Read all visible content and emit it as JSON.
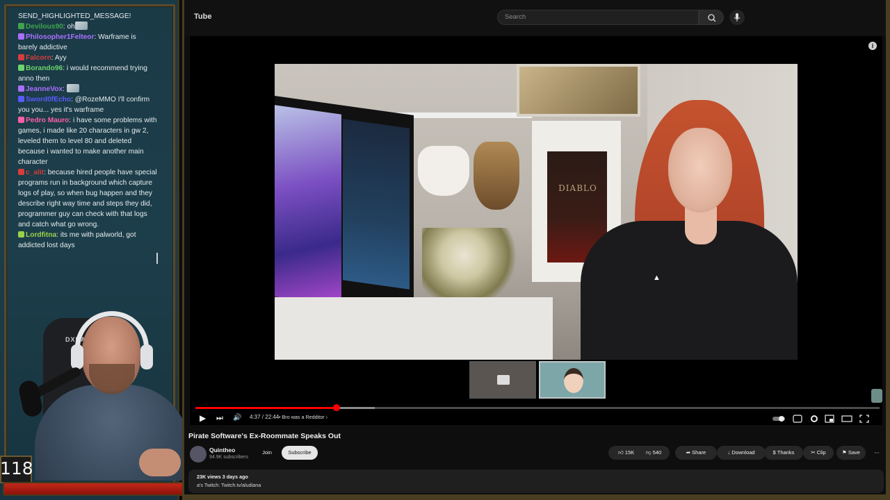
{
  "chat": {
    "messages": [
      {
        "user": "",
        "user_color": "#e8ecef",
        "text": "SEND_HIGHLIGHTED_MESSAGE!"
      },
      {
        "user": "Devilous90",
        "user_color": "#3fa34d",
        "text": "oh",
        "emote": true
      },
      {
        "user": "Philosopher1Felteor",
        "user_color": "#a970ff",
        "text": "Warframe is barely addictive"
      },
      {
        "user": "Falcorn",
        "user_color": "#d63c3c",
        "text": "Ayy"
      },
      {
        "user": "Borando96",
        "user_color": "#6bd36b",
        "text": "i would recommend trying anno then"
      },
      {
        "user": "JeanneVox",
        "user_color": "#a970ff",
        "text": "",
        "emote": true
      },
      {
        "user": "Sword0fEcho",
        "user_color": "#5b5bff",
        "text": "@RozeMMO I'll confirm you you... yes it's warframe"
      },
      {
        "user": "Pedro Mauro",
        "user_color": "#ff5ea8",
        "text": "i have some problems with games, i made like 20 characters in gw 2, leveled them to level 80 and deleted because i wanted to make another main character"
      },
      {
        "user": "c_alit",
        "user_color": "#d63c3c",
        "text": "because hired people have special programs run in background which capture logs of play, so when bug happen and they describe right way time and steps they did, programmer guy can check with that logs and catch what go wrong."
      },
      {
        "user": "Lordfitna",
        "user_color": "#9ad14b",
        "text": "its me with palworld, got addicted lost days"
      }
    ]
  },
  "overlay": {
    "level": "118",
    "chair_logo": "DXRACER"
  },
  "browser": {
    "logo": "Tube",
    "search_placeholder": "Search"
  },
  "player": {
    "time": "4:37 / 22:44",
    "chapter": "• Bro was a Redditor ›",
    "progress_played": 0.206,
    "progress_buffered": 0.262,
    "controls": {
      "play": "▶",
      "next": "⏭",
      "volume": "🔊"
    },
    "video_scene": {
      "poster_text": "DIABLO"
    }
  },
  "video_meta": {
    "title": "Pirate Software's Ex-Roommate Speaks Out",
    "channel": "Quintheo",
    "subscribers": "94.9K subscribers",
    "join": "Join",
    "subscribe": "Subscribe",
    "likes": "15K",
    "dislikes": "540",
    "share": "Share",
    "download": "Download",
    "thanks": "Thanks",
    "clip": "Clip",
    "save": "Save",
    "more": "⋯",
    "views_date": "23K views  3 days ago",
    "description_line": "a's Twitch: Twitch.tv/aludiana"
  }
}
